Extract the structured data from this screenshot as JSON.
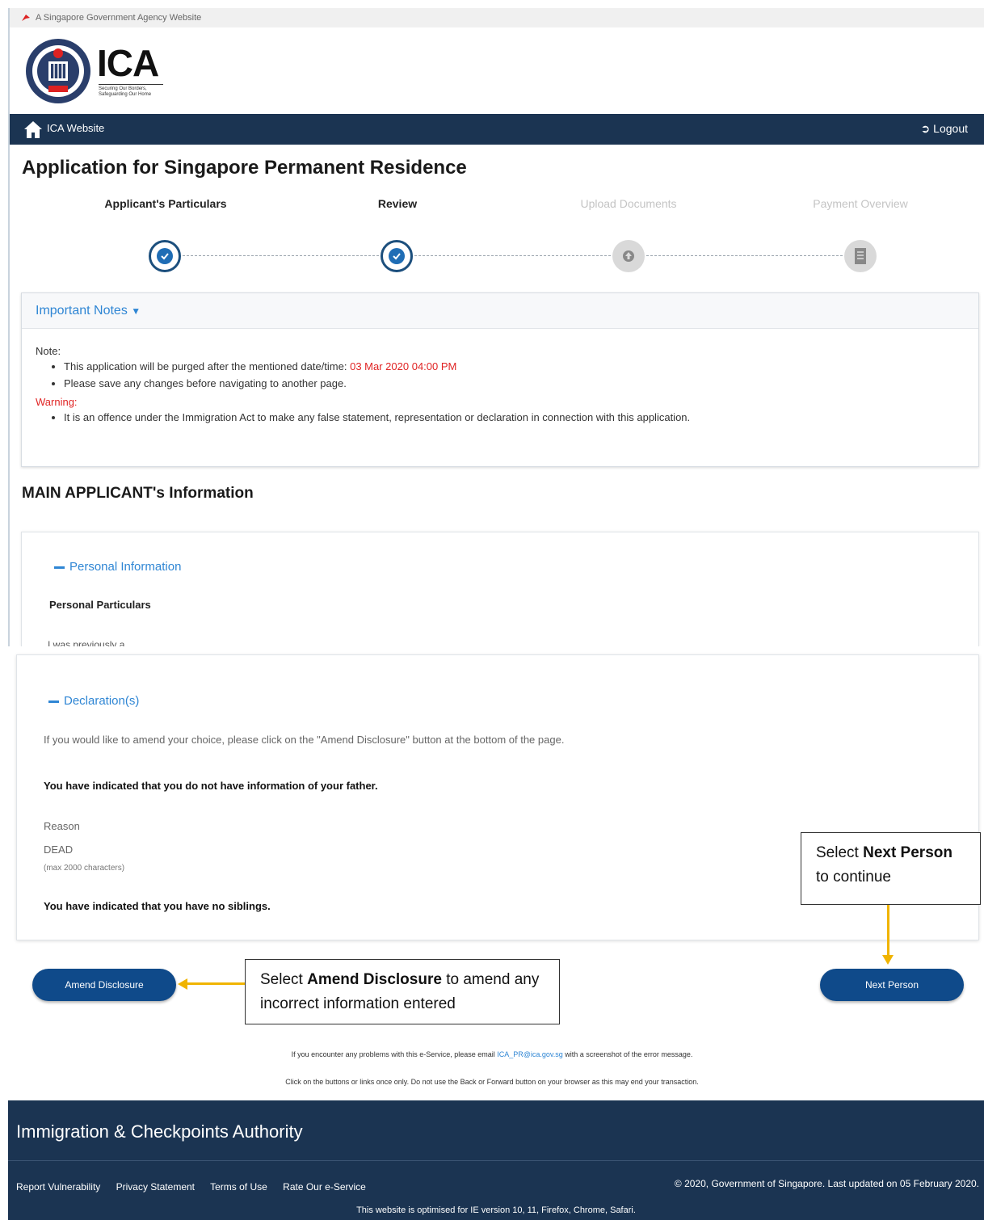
{
  "gov_banner": {
    "text": "A Singapore Government Agency Website"
  },
  "logo": {
    "text": "ICA",
    "tagline": "Securing Our Borders, Safeguarding Our Home"
  },
  "navbar": {
    "home_label": "ICA Website",
    "logout_label": "Logout"
  },
  "page": {
    "title": "Application for Singapore Permanent Residence"
  },
  "steps": [
    {
      "label": "Applicant's Particulars",
      "status": "done"
    },
    {
      "label": "Review",
      "status": "done"
    },
    {
      "label": "Upload Documents",
      "status": "todo"
    },
    {
      "label": "Payment Overview",
      "status": "todo"
    }
  ],
  "notes": {
    "header": "Important Notes",
    "note_label": "Note:",
    "purge_text": "This application will be purged after the mentioned date/time:",
    "purge_datetime": "03 Mar 2020 04:00 PM",
    "save_text": "Please save any changes before navigating to another page.",
    "warning_label": "Warning:",
    "warning_text": "It is an offence under the Immigration Act to make any false statement, representation or declaration in connection with this application."
  },
  "main_section": {
    "title": "MAIN APPLICANT's Information"
  },
  "personal": {
    "toggle_label": "Personal Information",
    "subhead": "Personal Particulars",
    "cropped_line": "I was previously a"
  },
  "declaration": {
    "toggle_label": "Declaration(s)",
    "amend_hint": "If you would like to amend your choice, please click on the \"Amend Disclosure\" button at the bottom of the page.",
    "father_text": "You have indicated that you do not have information of your father.",
    "reason_label": "Reason",
    "reason_value": "DEAD",
    "max_chars": "(max 2000 characters)",
    "siblings_text": "You have indicated that you have no siblings."
  },
  "buttons": {
    "amend": "Amend Disclosure",
    "next": "Next Person"
  },
  "callouts": {
    "amend_pre": "Select ",
    "amend_bold": "Amend Disclosure",
    "amend_post": " to amend any incorrect information entered",
    "next_pre": "Select ",
    "next_bold": "Next Person",
    "next_post": " to continue"
  },
  "help": {
    "line1_pre": "If you encounter any problems with this e-Service, please email",
    "email": "ICA_PR@ica.gov.sg",
    "line1_post": "with a screenshot of the error message.",
    "line2": "Click on the buttons or links once only. Do not use the Back or Forward button on your browser as this may end your transaction."
  },
  "footer": {
    "title": "Immigration & Checkpoints Authority",
    "links": [
      "Report Vulnerability",
      "Privacy Statement",
      "Terms of Use",
      "Rate Our e-Service"
    ],
    "copyright": "© 2020, Government of Singapore. Last updated on 05 February 2020.",
    "optimised": "This website is optimised for IE version 10, 11, Firefox, Chrome, Safari."
  },
  "colors": {
    "navy": "#1b3452",
    "accent_blue": "#2f86d4",
    "button_blue": "#0f4a8a",
    "warning_red": "#e02424",
    "arrow_yellow": "#f0b400"
  }
}
